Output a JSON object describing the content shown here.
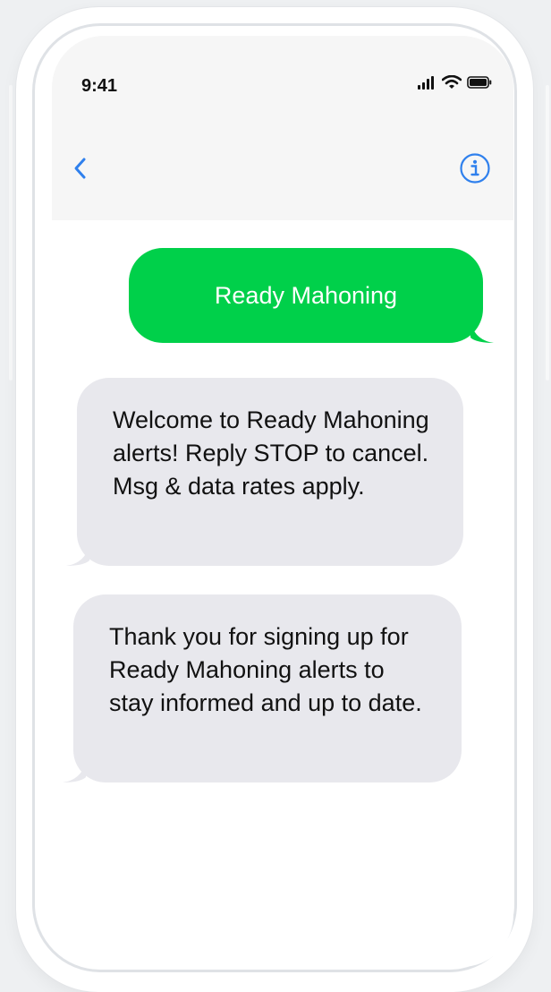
{
  "status_bar": {
    "time": "9:41"
  },
  "nav": {
    "back_icon": "chevron-left-icon",
    "info_icon": "info-circle-icon",
    "accent_color": "#2f80ed"
  },
  "messages": [
    {
      "direction": "sent",
      "text": "Ready Mahoning",
      "color": "#00d04a"
    },
    {
      "direction": "received",
      "text": "Welcome to Ready Mahoning alerts! Reply STOP to cancel. Msg & data rates apply.",
      "color": "#e8e8ed"
    },
    {
      "direction": "received",
      "text": "Thank you for signing up for Ready Mahoning alerts to stay informed and up to date.",
      "color": "#e8e8ed"
    }
  ]
}
